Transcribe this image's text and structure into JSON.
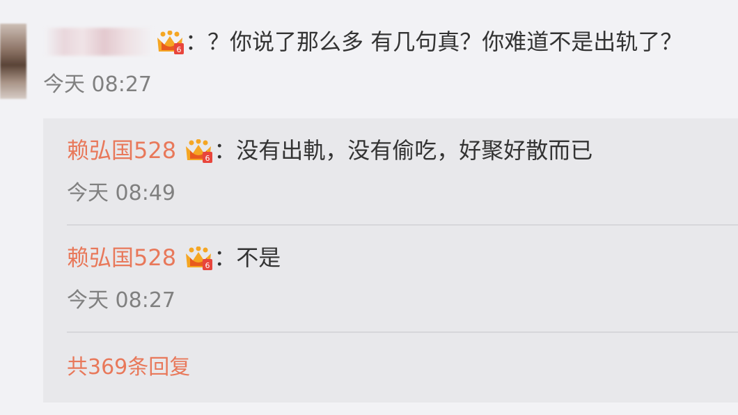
{
  "comment": {
    "separator": "：",
    "text": "？你说了那么多 有几句真？你难道不是出轨了？",
    "time": "今天 08:27",
    "badge_icon": "vip-crown-icon"
  },
  "replies": [
    {
      "username": "赖弘国528",
      "separator": "：",
      "text": "没有出軌，没有偷吃，好聚好散而已",
      "time": "今天 08:49"
    },
    {
      "username": "赖弘国528",
      "separator": "：",
      "text": "不是",
      "time": "今天 08:27"
    }
  ],
  "more_replies_label": "共369条回复",
  "colors": {
    "username": "#e8785a",
    "background": "#f2f2f5",
    "reply_box": "#e8e8eb"
  }
}
